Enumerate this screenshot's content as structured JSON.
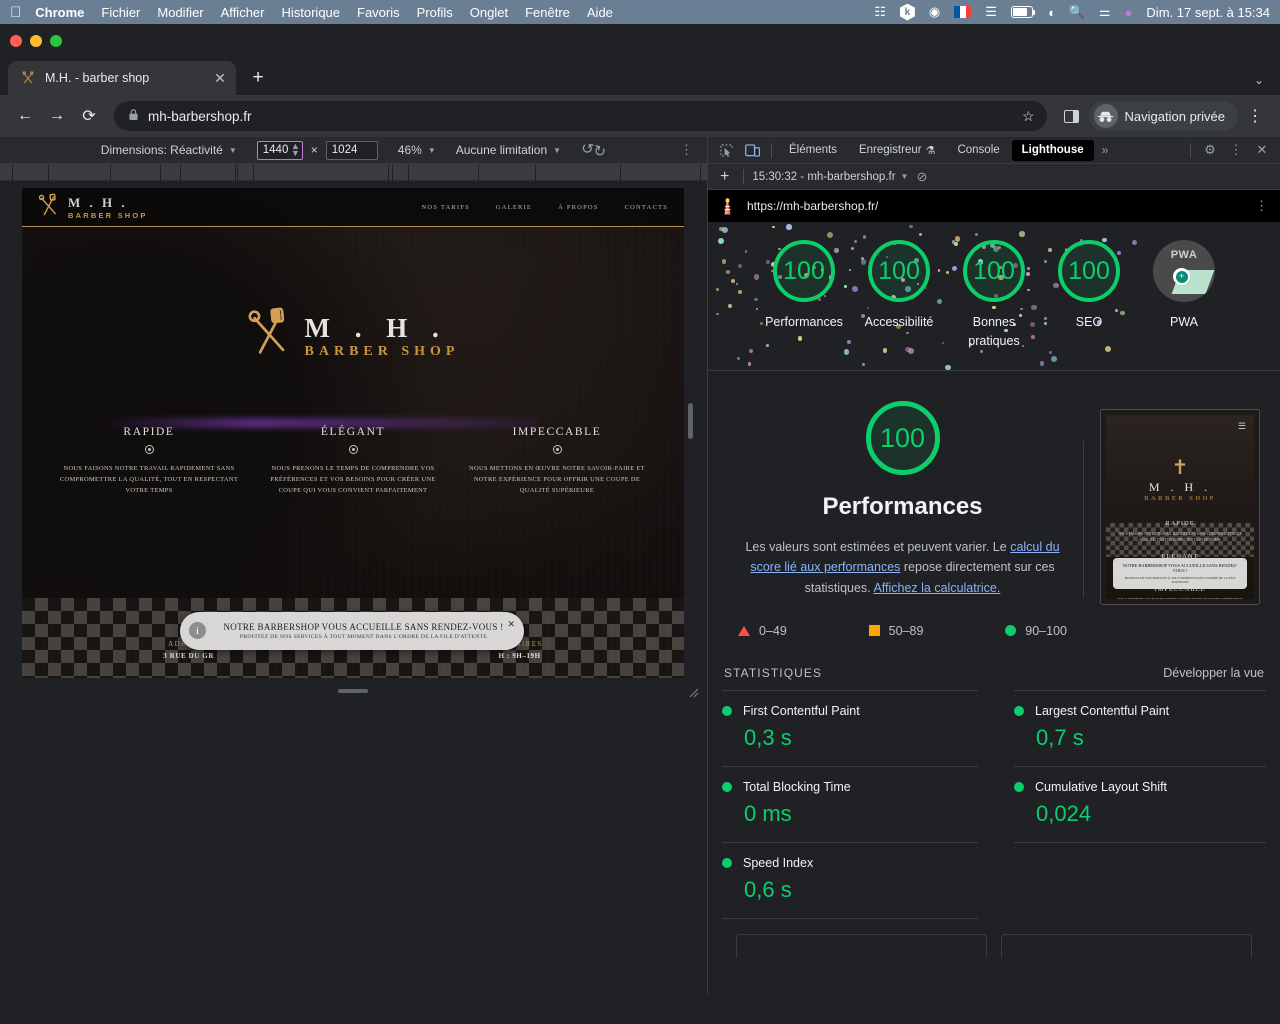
{
  "menubar": {
    "apple_icon": "apple-icon",
    "items": [
      "Chrome",
      "Fichier",
      "Modifier",
      "Afficher",
      "Historique",
      "Favoris",
      "Profils",
      "Onglet",
      "Fenêtre",
      "Aide"
    ],
    "status_icons": [
      "figma-icon",
      "k-app-icon",
      "record-icon",
      "french-flag-icon",
      "bluetooth-icon",
      "battery-charging-icon",
      "wifi-icon",
      "spotlight-search-icon",
      "control-center-icon",
      "siri-icon"
    ],
    "clock": "Dim. 17 sept. à  15:34"
  },
  "browser": {
    "tab": {
      "title": "M.H. - barber shop",
      "favicon": "scissors-icon",
      "close": "✕"
    },
    "new_tab": "+",
    "tab_list_chevron": "⌄",
    "nav": {
      "back": "←",
      "forward": "→",
      "reload": "⟳"
    },
    "omnibox": {
      "lock": "lock-icon",
      "url": "mh-barbershop.fr",
      "star": "☆"
    },
    "side_panel": "side-panel-icon",
    "incognito_label": "Navigation privée",
    "menu": "⋮"
  },
  "device_toolbar": {
    "dimensions_label": "Dimensions: Réactivité",
    "width": "1440",
    "times": "×",
    "height": "1024",
    "zoom": "46%",
    "throttling": "Aucune limitation",
    "rotate_icon": "rotate-icon",
    "more_icon": "⋮"
  },
  "devtools": {
    "inspect_icon": "inspect-icon",
    "device_toggle_icon": "device-toolbar-icon",
    "tabs": [
      {
        "label": "Éléments",
        "active": false
      },
      {
        "label": "Enregistreur",
        "active": false,
        "badge": "flask-icon"
      },
      {
        "label": "Console",
        "active": false
      },
      {
        "label": "Lighthouse",
        "active": true
      }
    ],
    "overflow": "»",
    "settings_icon": "gear-icon",
    "kebab_icon": "⋮",
    "close_icon": "✕"
  },
  "lighthouse": {
    "toolbar": {
      "add_icon": "+",
      "run_label": "15:30:32 - mh-barbershop.fr",
      "caret": "▾",
      "clear_icon": "clear-icon"
    },
    "report_url": "https://mh-barbershop.fr/",
    "report_icon": "lighthouse-icon",
    "report_kebab": "⋮",
    "gauges": [
      {
        "score": "100",
        "label": "Performances"
      },
      {
        "score": "100",
        "label": "Accessibilité"
      },
      {
        "score": "100",
        "label": "Bonnes\npratique"
      },
      {
        "score": "100",
        "label": "SEO"
      },
      {
        "score": "PWA",
        "label": "PWA",
        "is_pwa": true
      }
    ],
    "gauge_labels": [
      "Performances",
      "Accessibilité",
      "Bonnes pratiques",
      "SEO",
      "PWA"
    ],
    "performance": {
      "score": "100",
      "title": "Performances",
      "desc_part1": "Les valeurs sont estimées et peuvent varier. Le ",
      "desc_link1": "calcul du score lié aux performances",
      "desc_part2": " repose directement sur ces statistiques. ",
      "desc_link2": "Affichez la calculatrice.",
      "legend": [
        {
          "icon": "triangle",
          "range": "0–49"
        },
        {
          "icon": "square",
          "range": "50–89"
        },
        {
          "icon": "circle",
          "range": "90–100"
        }
      ]
    },
    "stats": {
      "heading": "STATISTIQUES",
      "expand": "Développer la vue",
      "metrics": [
        {
          "name": "First Contentful Paint",
          "value": "0,3 s",
          "status": "good"
        },
        {
          "name": "Largest Contentful Paint",
          "value": "0,7 s",
          "status": "good"
        },
        {
          "name": "Total Blocking Time",
          "value": "0 ms",
          "status": "good"
        },
        {
          "name": "Cumulative Layout Shift",
          "value": "0,024",
          "status": "good"
        },
        {
          "name": "Speed Index",
          "value": "0,6 s",
          "status": "good"
        }
      ]
    },
    "colors": {
      "good": "#0cce6b",
      "average": "#ffa400",
      "poor": "#ff4e42",
      "link": "#8ab4f8"
    }
  },
  "site": {
    "brand": {
      "name": "M . H .",
      "sub": "BARBER SHOP",
      "logo": "scissors-comb-icon"
    },
    "nav": [
      "NOS TARIFS",
      "GALERIE",
      "À PROPOS",
      "CONTACTS"
    ],
    "features": [
      {
        "title": "RAPIDE",
        "text": "NOUS FAISONS NOTRE TRAVAIL RAPIDEMENT SANS COMPROMETTRE LA QUALITÉ, TOUT EN RESPECTANT VOTRE TEMPS"
      },
      {
        "title": "ÉLÉGANT",
        "text": "NOUS PRENONS LE TEMPS DE COMPRENDRE VOS PRÉFÉRENCES ET VOS BESOINS POUR CRÉER UNE COUPE QUI VOUS CONVIENT PARFAITEMENT"
      },
      {
        "title": "IMPECCABLE",
        "text": "NOUS METTONS EN ŒUVRE NOTRE SAVOIR-FAIRE ET NOTRE EXPÉRIENCE POUR OFFRIR UNE COUPE DE QUALITÉ SUPÉRIEURE"
      }
    ],
    "footer": [
      {
        "head": "ADRESSE",
        "value": "3 RUE DU GR"
      },
      {
        "head": "HORAIRES",
        "value": "H : 9H–19H"
      }
    ],
    "notification": {
      "icon": "info-icon",
      "title": "NOTRE BARBERSHOP VOUS ACCUEILLE SANS RENDEZ-VOUS !",
      "subtitle": "PROFITEZ DE NOS SERVICES À TOUT MOMENT DANS L'ORDRE DE LA FILE D'ATTENTE",
      "close": "✕"
    }
  }
}
